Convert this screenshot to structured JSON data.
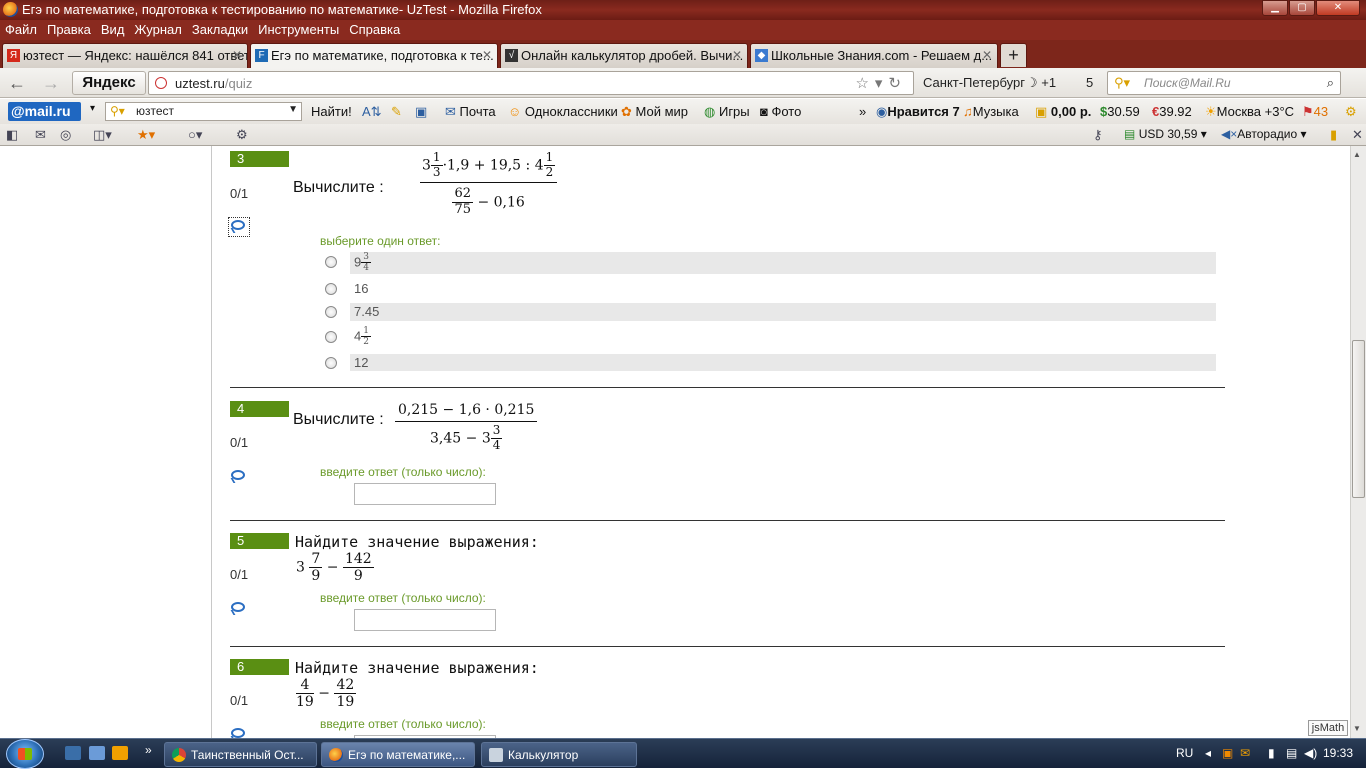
{
  "window": {
    "title": "Егэ по математике, подготовка к тестированию по математике- UzTest - Mozilla Firefox",
    "controls": {
      "minimize": "▁",
      "maximize": "▢",
      "close": "✕"
    }
  },
  "menu": [
    "Файл",
    "Правка",
    "Вид",
    "Журнал",
    "Закладки",
    "Инструменты",
    "Справка"
  ],
  "tabs": [
    {
      "label": "юзтест — Яндекс: нашёлся 841 ответ",
      "icon": "yandex-favicon",
      "color": "#d4281a",
      "glyph": "Я"
    },
    {
      "label": "Егэ по математике, подготовка к те...",
      "icon": "uztest-favicon",
      "color": "#1f6bb5",
      "glyph": "F",
      "active": true
    },
    {
      "label": "Онлайн калькулятор дробей. Вычи...",
      "icon": "calc-favicon",
      "color": "#333333",
      "glyph": "√"
    },
    {
      "label": "Школьные Знания.com - Решаем д...",
      "icon": "znania-favicon",
      "color": "#3a7ad0",
      "glyph": "◆"
    }
  ],
  "new_tab": "+",
  "nav": {
    "back": "←",
    "forward": "→",
    "yandex_button": "Яндекс",
    "url_host": "uztest.ru",
    "url_path": "/quiz",
    "city": "Санкт-Петербург",
    "weather": "+1",
    "mail_count": "5",
    "mail_search_placeholder": "Поиск@Mail.Ru"
  },
  "mailbar": {
    "logo": "@mail.ru",
    "search_value": "юзтест",
    "find_label": "Найти!",
    "items": [
      "Почта",
      "Одноклассники",
      "Мой мир",
      "Игры",
      "Фото"
    ],
    "more": "»",
    "likes": "Нравится 7",
    "music": "Музыка",
    "balance": "0,00 р.",
    "usd": "30.59",
    "eur": "39.92",
    "weather": "Москва +3°C",
    "traffic": "43"
  },
  "toolbar2": {
    "usd_rate": "USD 30,59",
    "radio": "Авторадио"
  },
  "questions": [
    {
      "number": "3",
      "score": "0/1",
      "prompt": "Вычислите :",
      "hint": "выберите один ответ:",
      "answers": [
        {
          "whole": "9",
          "num": "3",
          "den": "4"
        },
        {
          "text": "16"
        },
        {
          "text": "7.45"
        },
        {
          "whole": "4",
          "num": "1",
          "den": "2"
        },
        {
          "text": "12"
        }
      ],
      "expr": {
        "a_whole": "3",
        "a_num": "1",
        "a_den": "3",
        "rest": "·1,9 + 19,5 : 4",
        "b_num": "1",
        "b_den": "2",
        "d_num": "62",
        "d_den": "75",
        "d_rest": "− 0,16"
      }
    },
    {
      "number": "4",
      "score": "0/1",
      "prompt": "Вычислите :",
      "hint": "введите ответ (только число):",
      "expr": {
        "num": "0,215 − 1,6 · 0,215",
        "den_pre": "3,45 − 3",
        "den_num": "3",
        "den_den": "4"
      }
    },
    {
      "number": "5",
      "score": "0/1",
      "prompt": "Найдите значение выражения:",
      "hint": "введите ответ (только число):",
      "expr": {
        "whole": "3",
        "a_num": "7",
        "a_den": "9",
        "op": "−",
        "b_num": "142",
        "b_den": "9"
      }
    },
    {
      "number": "6",
      "score": "0/1",
      "prompt": "Найдите значение выражения:",
      "hint": "введите ответ (только число):",
      "expr": {
        "a_num": "4",
        "a_den": "19",
        "op": "−",
        "b_num": "42",
        "b_den": "19"
      }
    }
  ],
  "jsmath_button": "jsMath",
  "taskbar": {
    "tasks": [
      "Таинственный Ост...",
      "Егэ по математике,...",
      "Калькулятор"
    ],
    "lang": "RU",
    "time": "19:33"
  }
}
